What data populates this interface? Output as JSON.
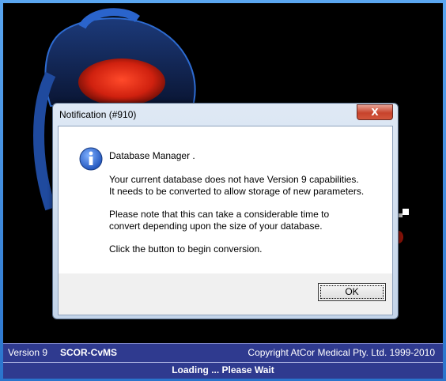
{
  "app": {
    "version_label": "Version 9",
    "product_name": "SCOR-CvMS",
    "copyright": "Copyright AtCor Medical Pty. Ltd. 1999-2010",
    "loading": "Loading ... Please Wait"
  },
  "dialog": {
    "title": "Notification  (#910)",
    "close_label": "X",
    "heading": "Database Manager .",
    "message_1": "Your current database does not have Version 9 capabilities.\nIt needs to be converted to allow storage of new parameters.",
    "message_2": "Please note that this can take a considerable time to\nconvert depending upon the size of your database.",
    "message_3": "Click the button to begin conversion.",
    "ok_label": "OK",
    "icon": "info-icon"
  },
  "colors": {
    "frame": "#2f7fd6",
    "splash_bg": "#000000",
    "footer_bg": "#2f3a8f",
    "close_red": "#c7432c"
  }
}
